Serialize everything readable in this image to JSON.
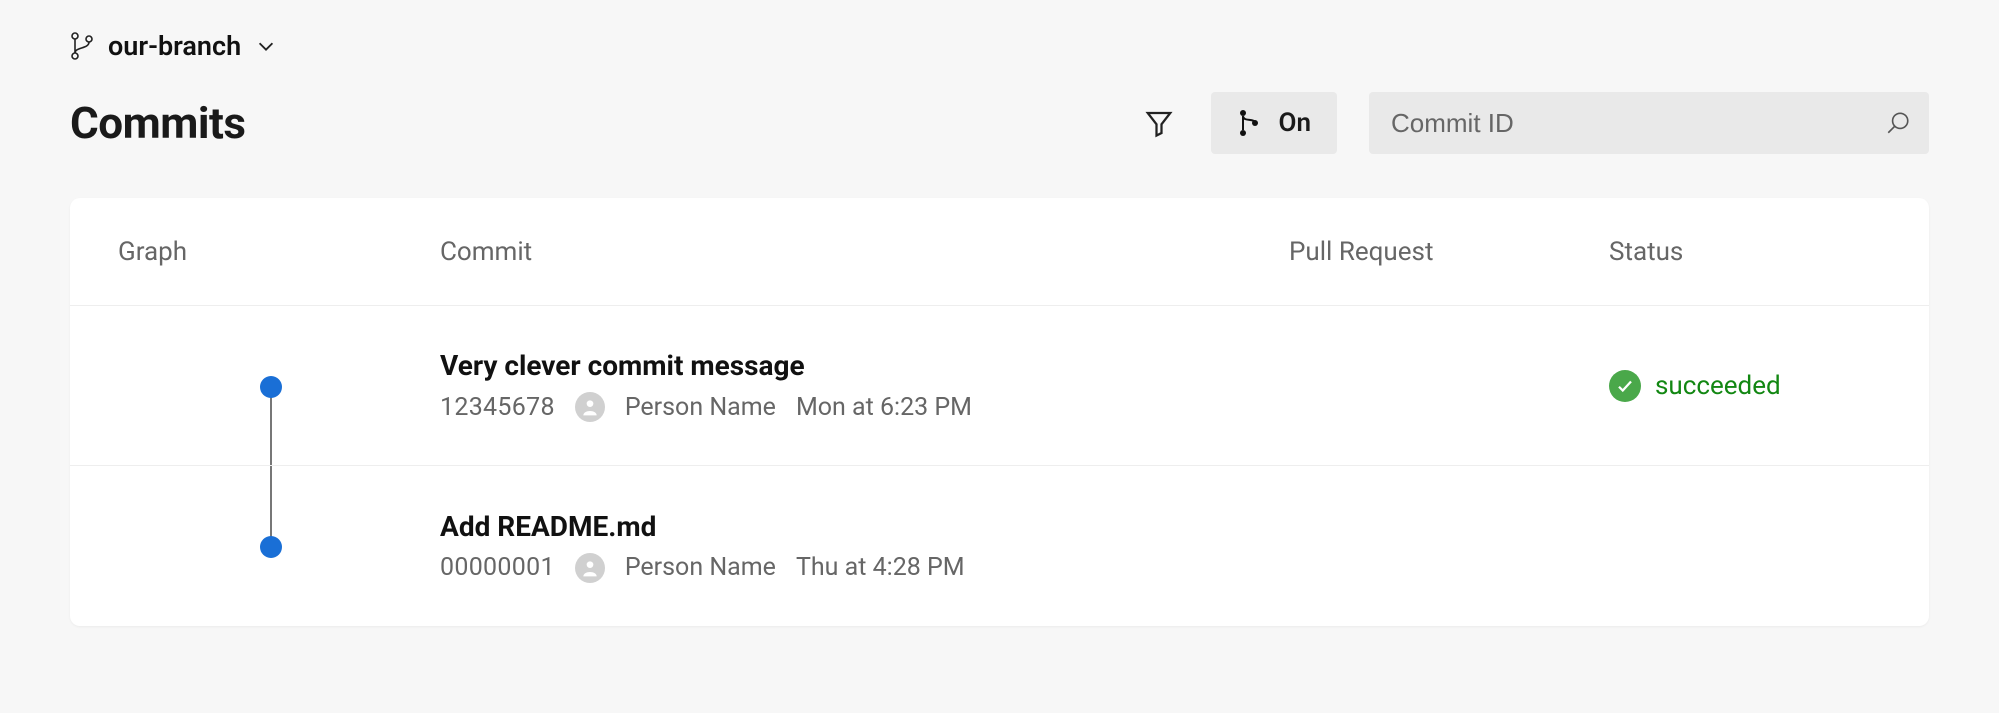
{
  "branch": {
    "name": "our-branch"
  },
  "title": "Commits",
  "toolbar": {
    "graph_toggle_label": "On",
    "search_placeholder": "Commit ID"
  },
  "columns": {
    "graph": "Graph",
    "commit": "Commit",
    "pull_request": "Pull Request",
    "status": "Status"
  },
  "commits": [
    {
      "message": "Very clever commit message",
      "hash": "12345678",
      "author": "Person Name",
      "time": "Mon at 6:23 PM",
      "status_label": "succeeded",
      "status_kind": "success"
    },
    {
      "message": "Add README.md",
      "hash": "00000001",
      "author": "Person Name",
      "time": "Thu at 4:28 PM",
      "status_label": "",
      "status_kind": "none"
    }
  ]
}
